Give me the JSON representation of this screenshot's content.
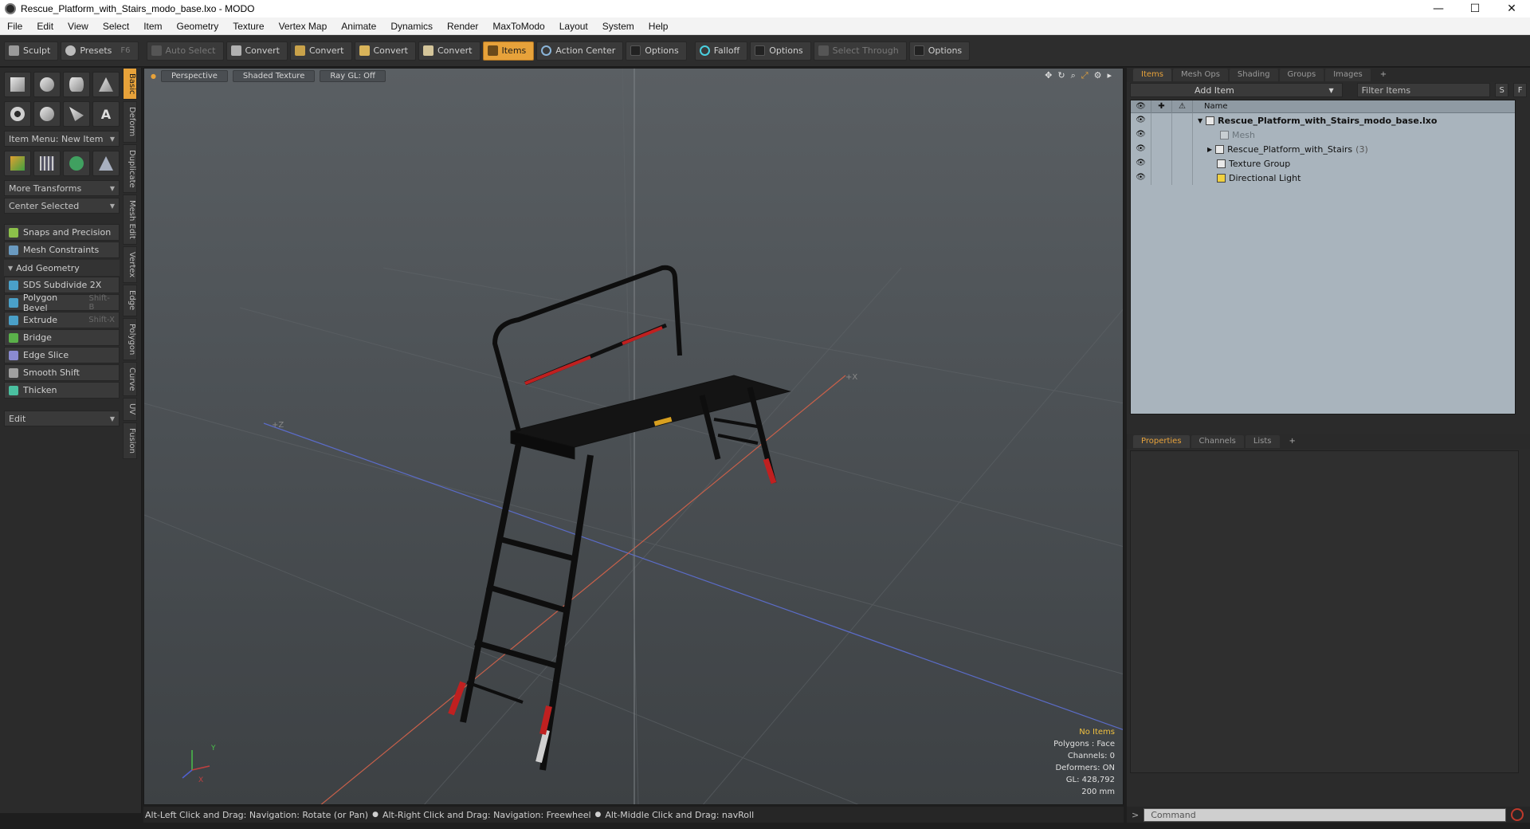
{
  "window": {
    "title": "Rescue_Platform_with_Stairs_modo_base.lxo - MODO",
    "minimize": "—",
    "maximize": "☐",
    "close": "✕"
  },
  "menu": [
    "File",
    "Edit",
    "View",
    "Select",
    "Item",
    "Geometry",
    "Texture",
    "Vertex Map",
    "Animate",
    "Dynamics",
    "Render",
    "MaxToModo",
    "Layout",
    "System",
    "Help"
  ],
  "toolbar": {
    "sculpt": "Sculpt",
    "presets": "Presets",
    "presets_shortcut": "F6",
    "auto_select": "Auto Select",
    "convert1": "Convert",
    "convert2": "Convert",
    "convert3": "Convert",
    "convert4": "Convert",
    "items": "Items",
    "action_center": "Action Center",
    "options1": "Options",
    "falloff": "Falloff",
    "options2": "Options",
    "select_through": "Select Through",
    "options3": "Options"
  },
  "left": {
    "item_menu": "Item Menu: New Item",
    "more_transforms": "More Transforms",
    "center_selected": "Center Selected",
    "snaps": "Snaps and Precision",
    "mesh_constraints": "Mesh Constraints",
    "add_geometry": "Add Geometry",
    "tools": [
      {
        "label": "SDS Subdivide 2X",
        "shortcut": ""
      },
      {
        "label": "Polygon Bevel",
        "shortcut": "Shift-B"
      },
      {
        "label": "Extrude",
        "shortcut": "Shift-X"
      },
      {
        "label": "Bridge",
        "shortcut": ""
      },
      {
        "label": "Edge Slice",
        "shortcut": ""
      },
      {
        "label": "Smooth Shift",
        "shortcut": ""
      },
      {
        "label": "Thicken",
        "shortcut": ""
      }
    ],
    "edit": "Edit",
    "vtabs": [
      "Basic",
      "Deform",
      "Duplicate",
      "Mesh Edit",
      "Vertex",
      "Edge",
      "Polygon",
      "Curve",
      "UV",
      "Fusion"
    ]
  },
  "viewport": {
    "perspective": "Perspective",
    "shaded": "Shaded Texture",
    "raygl": "Ray GL: Off",
    "info": {
      "no_items": "No Items",
      "polygons": "Polygons : Face",
      "channels": "Channels: 0",
      "deformers": "Deformers: ON",
      "gl": "GL: 428,792",
      "scale": "200 mm"
    },
    "axis_z": "+Z",
    "axis_x": "+X",
    "gizmo_y": "Y",
    "gizmo_x": "X"
  },
  "right": {
    "tabs": [
      "Items",
      "Mesh Ops",
      "Shading",
      "Groups",
      "Images",
      "+"
    ],
    "add_item": "Add Item",
    "filter": "Filter Items",
    "s_btn": "S",
    "f_btn": "F",
    "col_name": "Name",
    "items": [
      {
        "label": "Rescue_Platform_with_Stairs_modo_base.lxo",
        "count": "",
        "expander": "▼"
      },
      {
        "label": "Mesh",
        "count": "",
        "expander": ""
      },
      {
        "label": "Rescue_Platform_with_Stairs",
        "count": "(3)",
        "expander": "▶"
      },
      {
        "label": "Texture Group",
        "count": "",
        "expander": ""
      },
      {
        "label": "Directional Light",
        "count": "",
        "expander": ""
      }
    ],
    "prop_tabs": [
      "Properties",
      "Channels",
      "Lists",
      "+"
    ]
  },
  "status": {
    "hint1": "Alt-Left Click and Drag: Navigation: Rotate (or Pan)",
    "hint2": "Alt-Right Click and Drag: Navigation: Freewheel",
    "hint3": "Alt-Middle Click and Drag: navRoll",
    "command_placeholder": "Command"
  },
  "colors": {
    "accent": "#e7a23a",
    "viewport_bg": "#4c5155",
    "item_list_bg": "#a9b4bd"
  }
}
